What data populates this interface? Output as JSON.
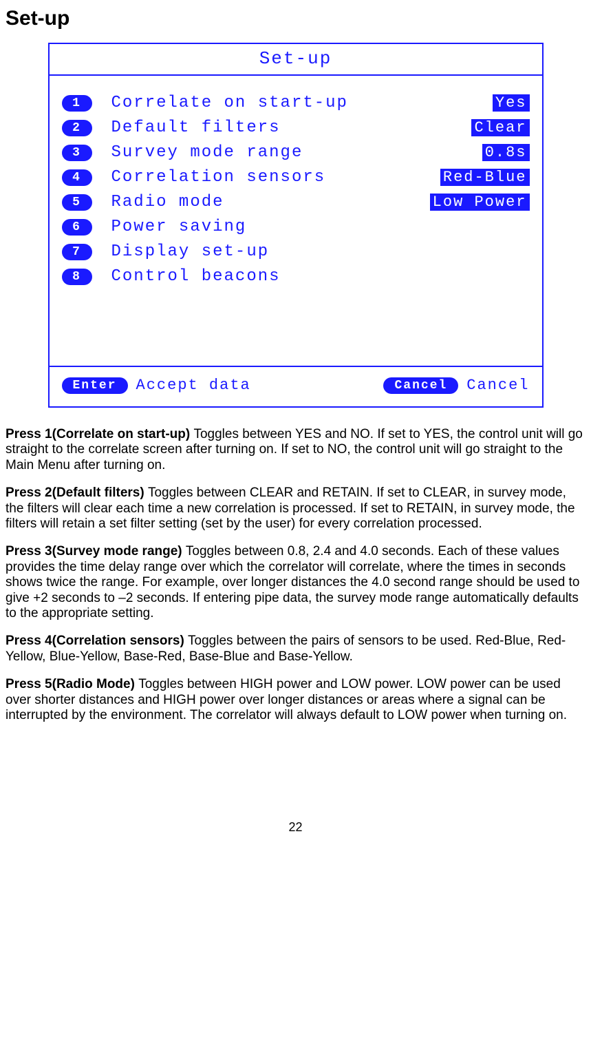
{
  "page": {
    "title": "Set-up",
    "page_number": "22"
  },
  "screen": {
    "title": "Set-up",
    "menu": [
      {
        "num": "1",
        "label": "Correlate on start-up",
        "value": "Yes"
      },
      {
        "num": "2",
        "label": "Default filters",
        "value": "Clear"
      },
      {
        "num": "3",
        "label": "Survey mode range",
        "value": "0.8s"
      },
      {
        "num": "4",
        "label": "Correlation sensors",
        "value": "Red-Blue"
      },
      {
        "num": "5",
        "label": "Radio mode",
        "value": "Low Power"
      },
      {
        "num": "6",
        "label": "Power saving",
        "value": ""
      },
      {
        "num": "7",
        "label": "Display set-up",
        "value": ""
      },
      {
        "num": "8",
        "label": "Control beacons",
        "value": ""
      }
    ],
    "bottom": {
      "enter_key": "Enter",
      "enter_label": "Accept data",
      "cancel_key": "Cancel",
      "cancel_label": "Cancel"
    }
  },
  "paragraphs": {
    "p1_bold": "Press 1(Correlate on start-up) ",
    "p1_text": "Toggles between YES and NO. If set to YES, the control unit will go straight to the correlate screen after turning on. If set to NO, the control unit will go straight to the Main Menu after turning on.",
    "p2_bold": "Press 2(Default filters) ",
    "p2_text": "Toggles between CLEAR and RETAIN. If set to CLEAR, in survey mode, the filters will clear each time a new correlation is processed. If set to RETAIN, in survey mode, the filters will retain a set filter setting (set by the user) for every correlation processed.",
    "p3_bold": "Press 3(Survey mode range) ",
    "p3_text": "Toggles between 0.8, 2.4 and 4.0 seconds. Each of these values provides the time delay range over which the correlator will correlate, where the times in seconds shows twice the range. For example, over longer distances the 4.0 second range should be used to give +2 seconds to –2 seconds. If entering pipe data, the survey mode range automatically defaults to the appropriate setting.",
    "p4_bold": "Press 4(Correlation sensors) ",
    "p4_text": "Toggles between the pairs of sensors to be used. Red-Blue, Red-Yellow, Blue-Yellow, Base-Red, Base-Blue and Base-Yellow.",
    "p5_bold": "Press 5(Radio Mode) ",
    "p5_text": "Toggles between HIGH power and LOW power. LOW power can be used over shorter distances and HIGH power over longer distances or areas where a signal can be interrupted by the environment. The correlator will always default to LOW power when turning on."
  }
}
